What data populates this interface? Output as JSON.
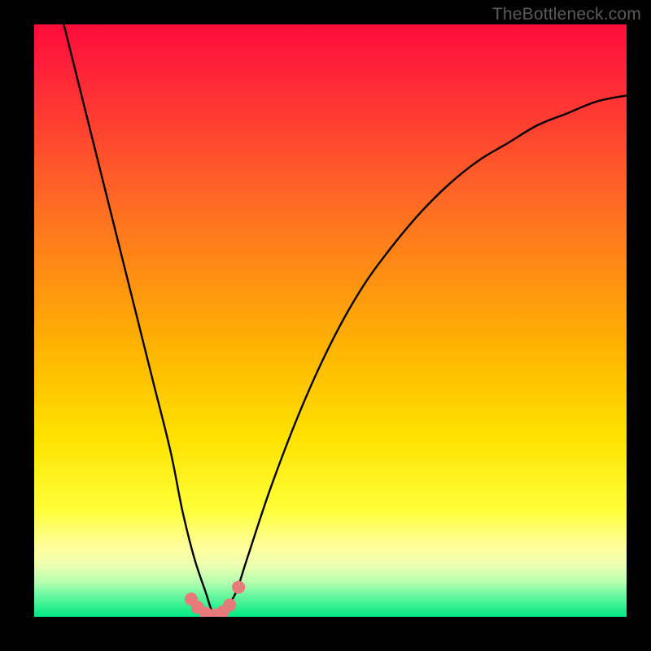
{
  "watermark": "TheBottleneck.com",
  "chart_data": {
    "type": "line",
    "title": "",
    "xlabel": "",
    "ylabel": "",
    "xlim": [
      0,
      100
    ],
    "ylim": [
      0,
      100
    ],
    "grid": false,
    "legend": false,
    "series": [
      {
        "name": "bottleneck-curve",
        "x": [
          5,
          8,
          11,
          14,
          17,
          20,
          23,
          25,
          27,
          29,
          30,
          31,
          32,
          34,
          36,
          40,
          45,
          50,
          55,
          60,
          65,
          70,
          75,
          80,
          85,
          90,
          95,
          100
        ],
        "y": [
          100,
          88,
          76,
          64,
          52,
          40,
          28,
          18,
          10,
          4,
          1,
          0,
          1,
          4,
          10,
          22,
          35,
          46,
          55,
          62,
          68,
          73,
          77,
          80,
          83,
          85,
          87,
          88
        ]
      }
    ],
    "markers": [
      {
        "x": 26.5,
        "y": 3.0,
        "r": 1.1
      },
      {
        "x": 27.6,
        "y": 1.6,
        "r": 1.1
      },
      {
        "x": 29.0,
        "y": 0.6,
        "r": 1.1
      },
      {
        "x": 30.5,
        "y": 0.3,
        "r": 1.1
      },
      {
        "x": 31.8,
        "y": 0.8,
        "r": 1.1
      },
      {
        "x": 33.0,
        "y": 2.0,
        "r": 1.1
      },
      {
        "x": 34.5,
        "y": 5.0,
        "r": 1.1
      }
    ],
    "marker_color": "#e77b7b",
    "curve_color": "#000000"
  }
}
